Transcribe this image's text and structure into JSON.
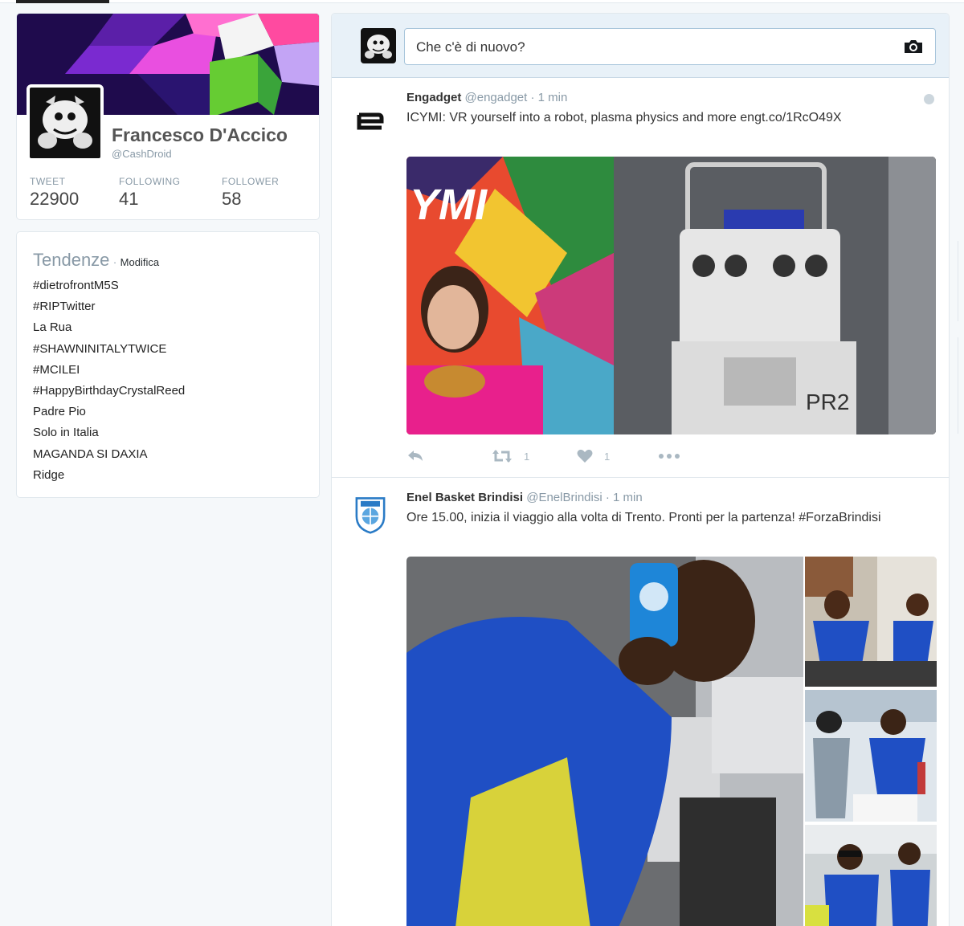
{
  "profile": {
    "name": "Francesco D'Accico",
    "handle": "@CashDroid",
    "stats": [
      {
        "label": "TWEET",
        "value": "22900"
      },
      {
        "label": "FOLLOWING",
        "value": "41"
      },
      {
        "label": "FOLLOWER",
        "value": "58"
      }
    ]
  },
  "trends": {
    "title": "Tendenze",
    "separator": "·",
    "edit_label": "Modifica",
    "items": [
      "#dietrofrontM5S",
      "#RIPTwitter",
      "La Rua",
      "#SHAWNINITALYTWICE",
      "#MCILEI",
      "#HappyBirthdayCrystalReed",
      "Padre Pio",
      "Solo in Italia",
      "MAGANDA SI DAXIA",
      "Ridge"
    ]
  },
  "compose": {
    "placeholder": "Che c'è di nuovo?"
  },
  "tweets": [
    {
      "name": "Engadget",
      "handle": "@engadget",
      "time": "· 1 min",
      "text": "ICYMI: VR yourself into a robot, plasma physics and more engt.co/1RcO49X",
      "retweets": "1",
      "likes": "1",
      "media_text": [
        "YMI",
        "PR2"
      ]
    },
    {
      "name": "Enel Basket Brindisi",
      "handle": "@EnelBrindisi",
      "time": "· 1 min",
      "text": "Ore 15.00, inizia il viaggio alla volta di Trento. Pronti per la partenza! #ForzaBrindisi"
    }
  ],
  "colors": {
    "banner_bg": "#1f0b4d",
    "link": "#8899a6",
    "heart": "#aab8c2"
  }
}
